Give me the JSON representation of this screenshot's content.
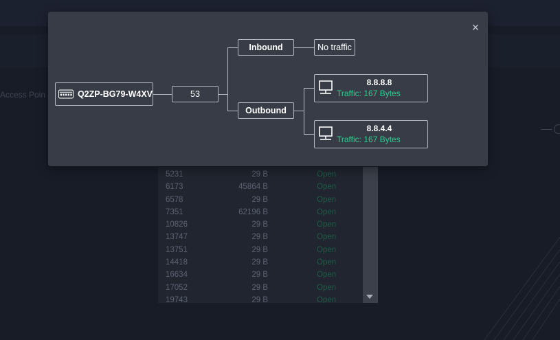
{
  "background": {
    "partial_label": "Access Poin",
    "ports_table": {
      "rows": [
        {
          "port": "5231",
          "size": "29 B",
          "status": "Open"
        },
        {
          "port": "6173",
          "size": "45864 B",
          "status": "Open"
        },
        {
          "port": "6578",
          "size": "29 B",
          "status": "Open"
        },
        {
          "port": "7351",
          "size": "62196 B",
          "status": "Open"
        },
        {
          "port": "10826",
          "size": "29 B",
          "status": "Open"
        },
        {
          "port": "13747",
          "size": "29 B",
          "status": "Open"
        },
        {
          "port": "13751",
          "size": "29 B",
          "status": "Open"
        },
        {
          "port": "14418",
          "size": "29 B",
          "status": "Open"
        },
        {
          "port": "16634",
          "size": "29 B",
          "status": "Open"
        },
        {
          "port": "17052",
          "size": "29 B",
          "status": "Open"
        },
        {
          "port": "19743",
          "size": "29 B",
          "status": "Open"
        }
      ]
    }
  },
  "modal": {
    "close_icon": "close-icon",
    "device": {
      "icon": "network-switch-icon",
      "name": "Q2ZP-BG79-W4XV"
    },
    "port": "53",
    "inbound": {
      "label": "Inbound",
      "result": "No traffic"
    },
    "outbound": {
      "label": "Outbound",
      "destinations": [
        {
          "icon": "computer-icon",
          "ip": "8.8.8.8",
          "traffic_label": "Traffic:",
          "traffic_value": "167 Bytes"
        },
        {
          "icon": "computer-icon",
          "ip": "8.8.4.4",
          "traffic_label": "Traffic:",
          "traffic_value": "167 Bytes"
        }
      ]
    }
  },
  "colors": {
    "page_bg": "#181c27",
    "modal_bg": "#373c47",
    "node_border": "#b5bac2",
    "traffic_green": "#2bd08f",
    "status_open_dim": "#1e5d48"
  }
}
